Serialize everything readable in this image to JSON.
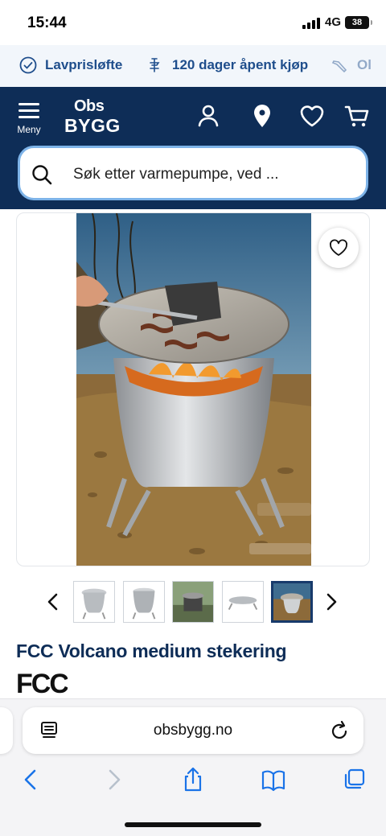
{
  "status_bar": {
    "time": "15:44",
    "network": "4G",
    "battery": "38"
  },
  "usp": [
    {
      "icon": "check-badge-icon",
      "label": "Lavprisløfte"
    },
    {
      "icon": "return-icon",
      "label": "120 dager åpent kjøp"
    },
    {
      "icon": "tool-icon",
      "label": "Ol"
    }
  ],
  "header": {
    "menu_label": "Meny",
    "logo_line1": "Obs",
    "logo_line2": "BYGG",
    "icons": [
      "user-icon",
      "store-location-icon",
      "wishlist-heart-icon",
      "cart-icon"
    ]
  },
  "search": {
    "placeholder": "Søk etter varmepumpe, ved ..."
  },
  "product": {
    "title": "FCC Volcano medium stekering",
    "brand": "FCC",
    "thumbnail_count": 5,
    "selected_thumbnail": 5
  },
  "browser": {
    "url": "obsbygg.no"
  },
  "colors": {
    "navy": "#0e2d57",
    "usp_text": "#1f4e8c",
    "search_border": "#7db3e8",
    "safari_blue": "#1a73e8"
  }
}
